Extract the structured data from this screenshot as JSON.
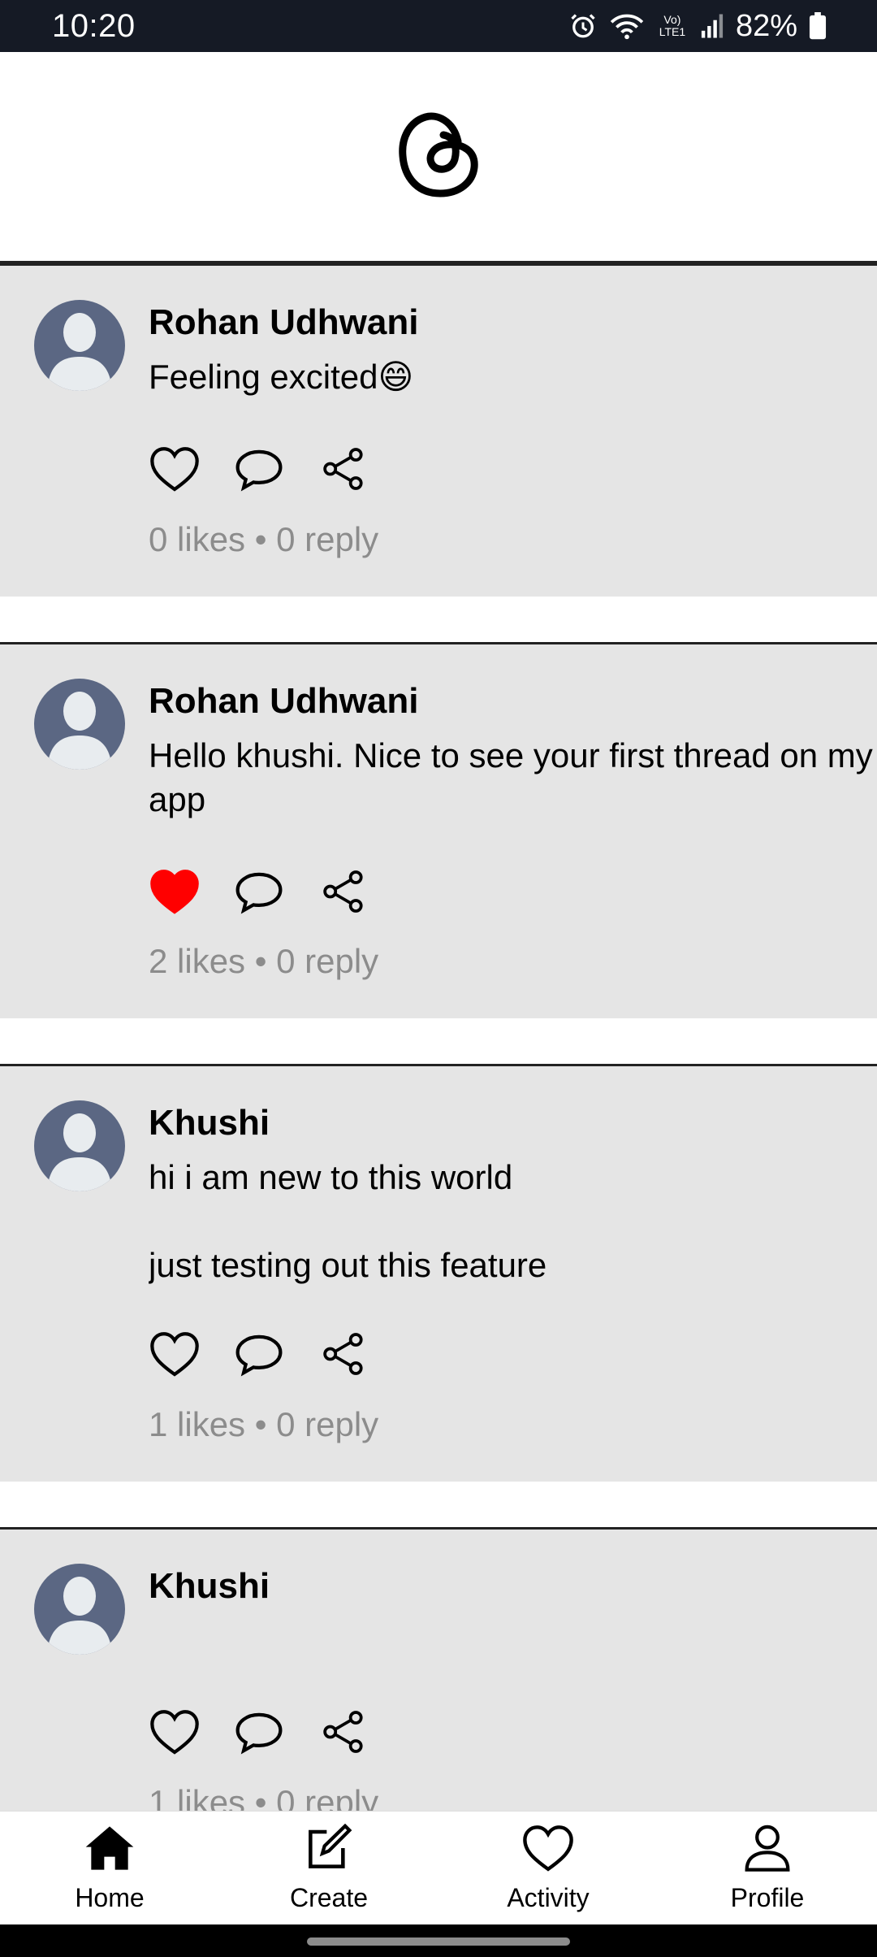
{
  "status_bar": {
    "time": "10:20",
    "network_label": "Vo) LTE1",
    "battery": "82%",
    "icons": [
      "alarm-icon",
      "wifi-icon",
      "signal-icon",
      "battery-icon"
    ]
  },
  "header": {
    "logo": "threads-logo-icon"
  },
  "posts": [
    {
      "author": "Rohan Udhwani",
      "content": "Feeling excited😄",
      "liked": false,
      "stats": "0 likes • 0 reply"
    },
    {
      "author": "Rohan Udhwani",
      "content": "Hello khushi. Nice to see your first thread on my\napp",
      "liked": true,
      "stats": "2 likes • 0 reply"
    },
    {
      "author": "Khushi",
      "content": "hi i am new to this world\n\njust testing out this feature",
      "liked": false,
      "stats": "1 likes • 0 reply"
    },
    {
      "author": "Khushi",
      "content": "",
      "liked": false,
      "stats": "1 likes • 0 reply"
    }
  ],
  "nav": {
    "home": "Home",
    "create": "Create",
    "activity": "Activity",
    "profile": "Profile"
  },
  "colors": {
    "status_bar": "#151a25",
    "card_bg": "#e5e5e5",
    "liked": "#ff0000",
    "avatar": "#5b6783",
    "muted_text": "#8c8c8c"
  }
}
